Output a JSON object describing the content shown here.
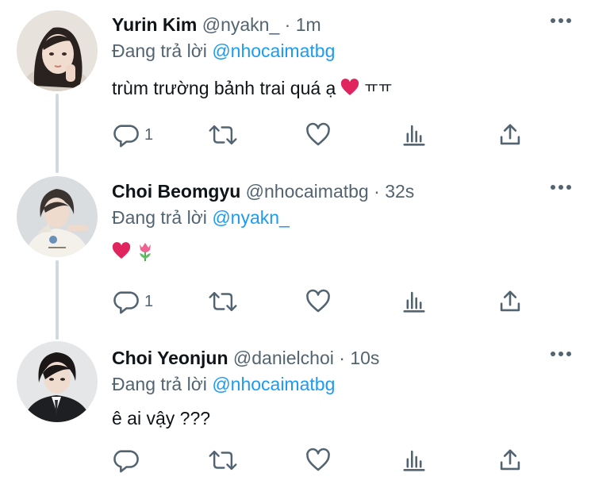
{
  "tweets": [
    {
      "name": "Yurin Kim",
      "handle": "@nyakn_",
      "dot": "·",
      "time": "1m",
      "reply_prefix": "Đang trả lời",
      "reply_to": "@nhocaimatbg",
      "text": "trùm trường bảnh trai quá ạ",
      "text_suffix": "ㅠㅠ",
      "reply_count": "1"
    },
    {
      "name": "Choi Beomgyu",
      "handle": "@nhocaimatbg",
      "dot": "·",
      "time": "32s",
      "reply_prefix": "Đang trả lời",
      "reply_to": "@nyakn_",
      "text": "",
      "text_suffix": "",
      "reply_count": "1"
    },
    {
      "name": "Choi Yeonjun",
      "handle": "@danielchoi",
      "dot": "·",
      "time": "10s",
      "reply_prefix": "Đang trả lời",
      "reply_to": "@nhocaimatbg",
      "text": "ê ai vậy ???",
      "text_suffix": "",
      "reply_count": ""
    }
  ],
  "icons": {
    "reply": "reply-icon",
    "retweet": "retweet-icon",
    "like": "heart-icon",
    "analytics": "analytics-icon",
    "share": "share-icon",
    "more": "more-icon",
    "emoji_heart": "red-heart-emoji",
    "emoji_tulip": "tulip-emoji"
  },
  "colors": {
    "link": "#1d9bf0",
    "secondary": "#536471",
    "heart_emoji": "#e0245e",
    "thread_line": "#cfd9de"
  }
}
